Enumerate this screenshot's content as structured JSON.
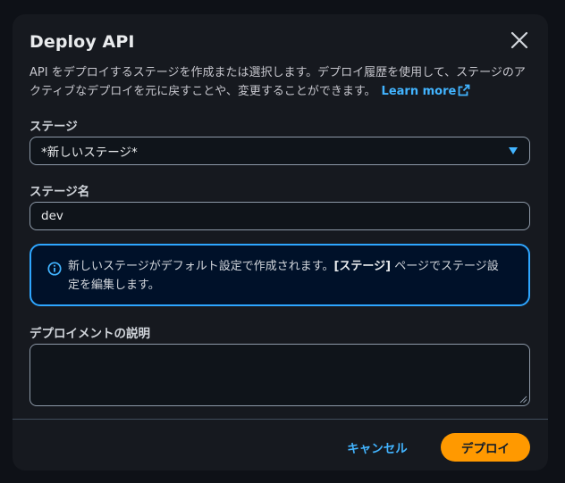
{
  "modal": {
    "title": "Deploy API",
    "description": "API をデプロイするステージを作成または選択します。デプロイ履歴を使用して、ステージのアクティブなデプロイを元に戻すことや、変更することができます。",
    "learn_more": "Learn more"
  },
  "stage": {
    "label": "ステージ",
    "selected": "*新しいステージ*"
  },
  "stage_name": {
    "label": "ステージ名",
    "value": "dev"
  },
  "alert": {
    "text_before": "新しいステージがデフォルト設定で作成されます。",
    "bold": "[ステージ]",
    "text_after": " ページでステージ設定を編集します。"
  },
  "deployment_description": {
    "label": "デプロイメントの説明",
    "value": ""
  },
  "footer": {
    "cancel": "キャンセル",
    "deploy": "デプロイ"
  },
  "colors": {
    "accent": "#ff9900",
    "link": "#42b4ff",
    "info_border": "#2ea6ff"
  }
}
